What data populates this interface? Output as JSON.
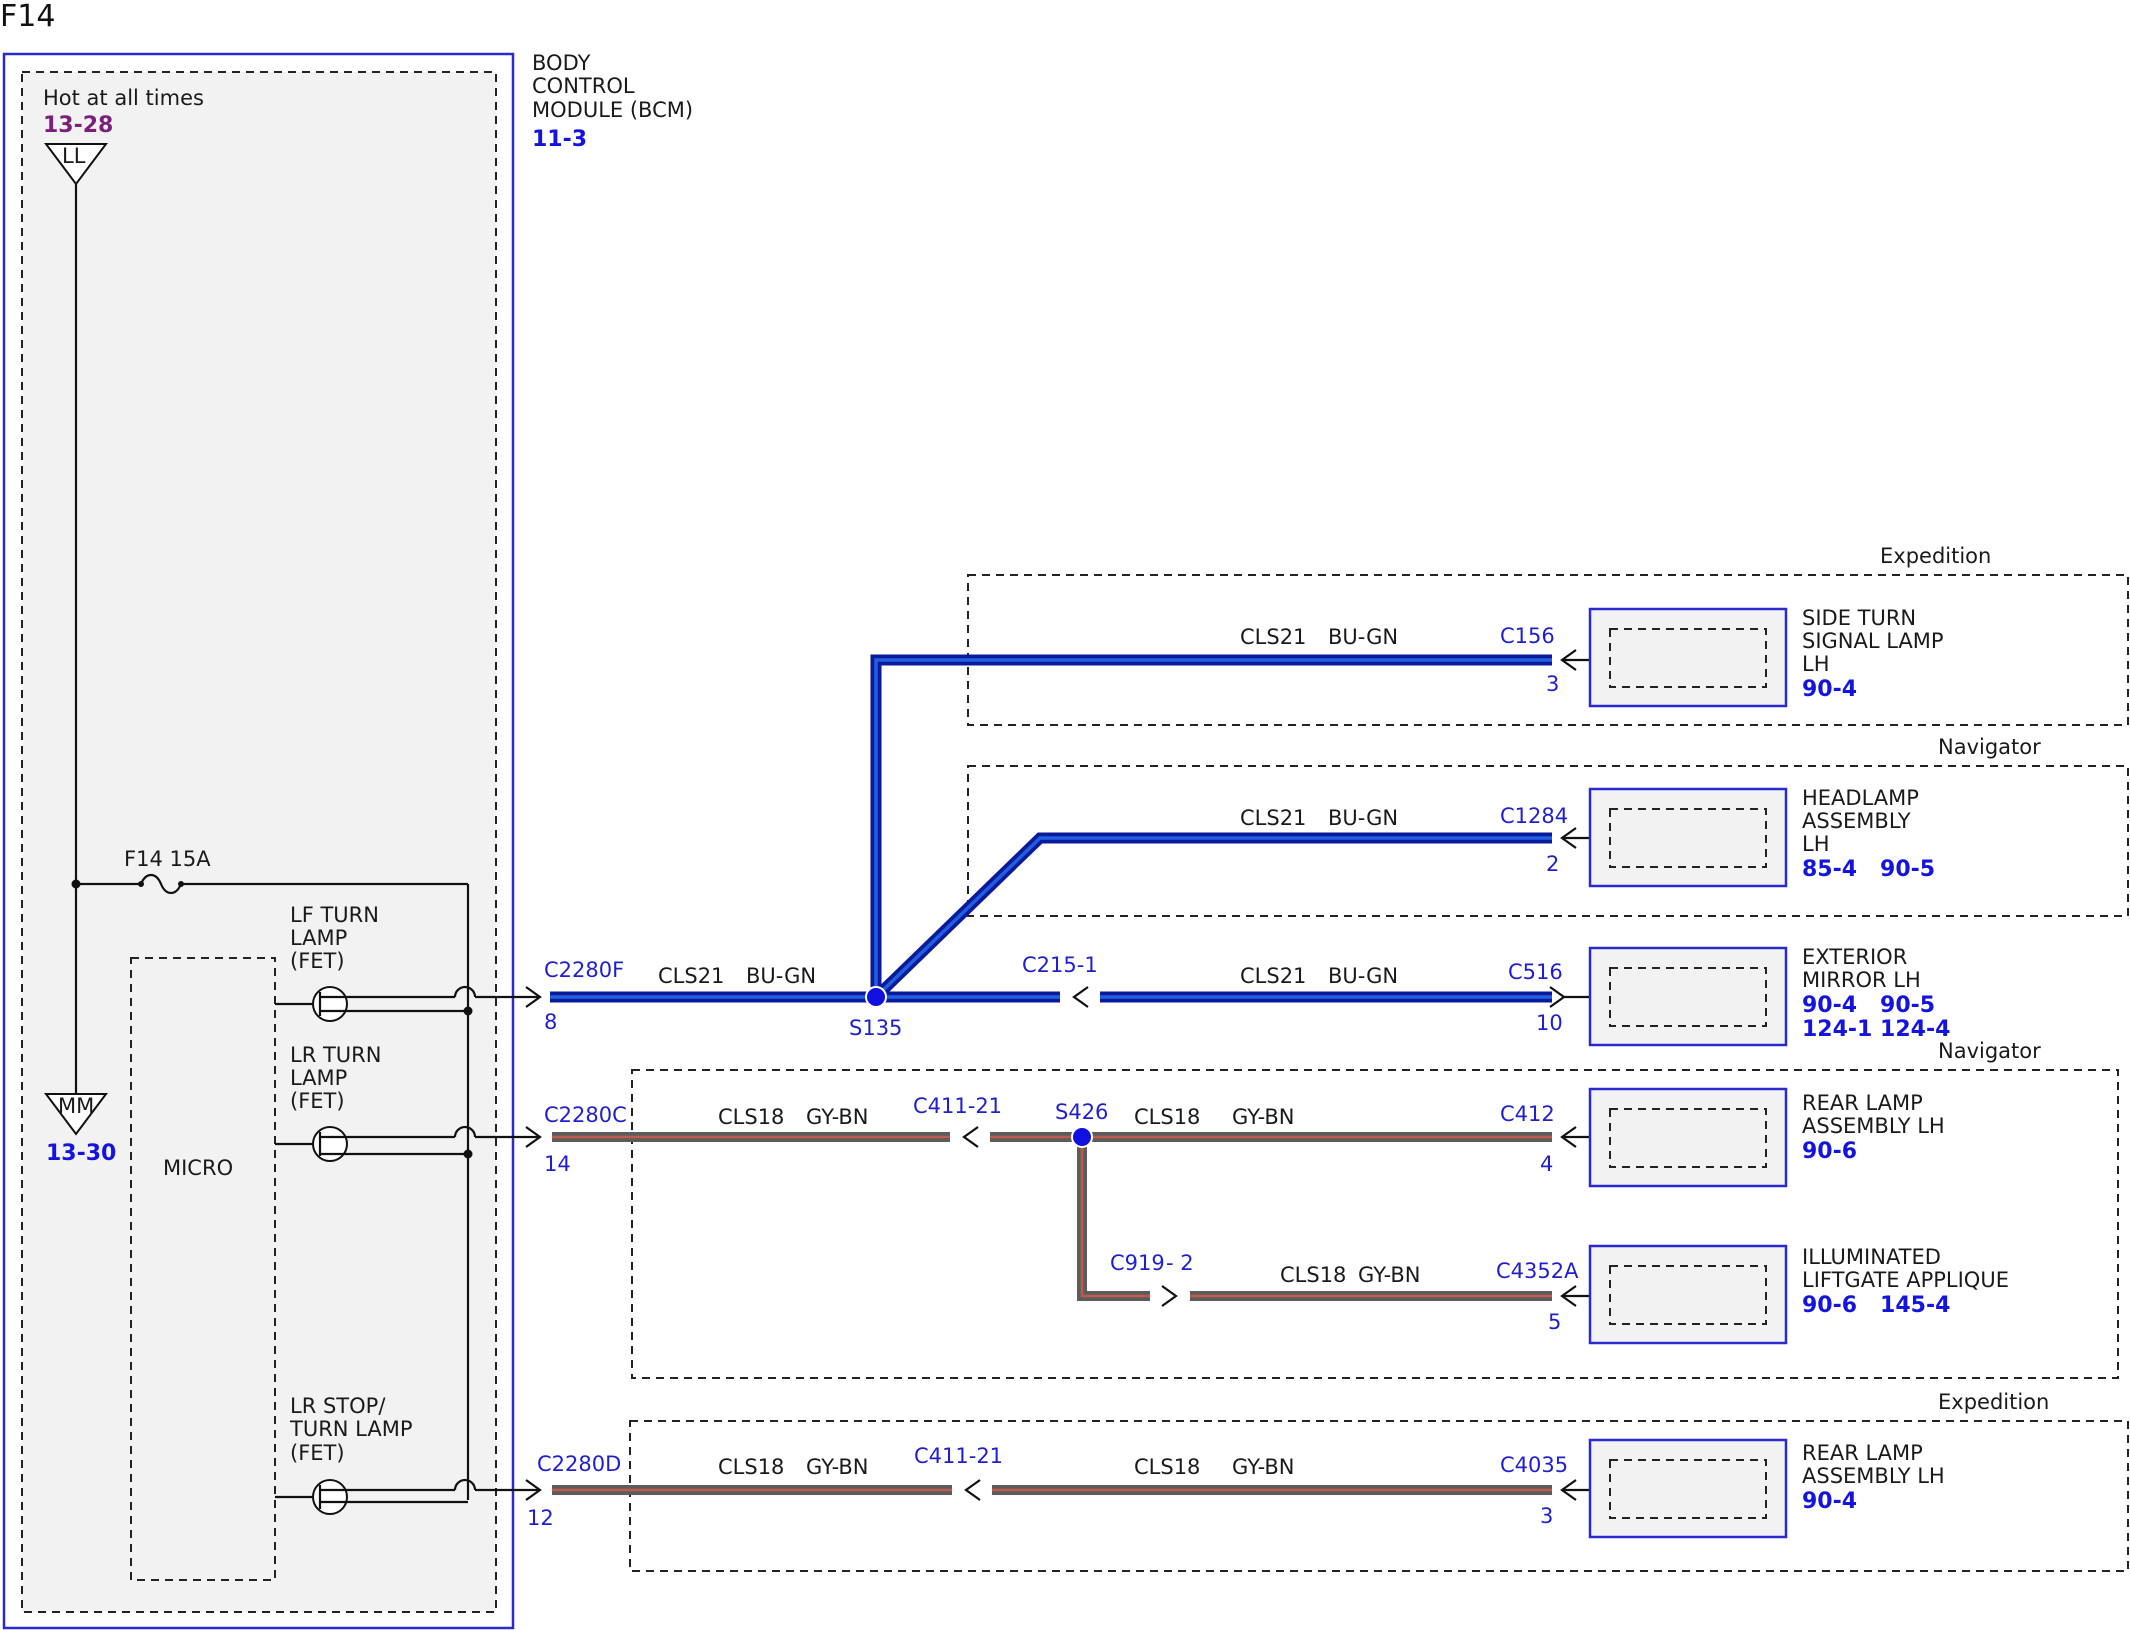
{
  "page": {
    "title": "F14"
  },
  "module": {
    "name_lines": [
      "BODY",
      "CONTROL",
      "MODULE (BCM)"
    ],
    "ref": "11-3",
    "hot_label": "Hot at all times",
    "hot_ref": "13-28",
    "top_terminal": "LL",
    "bottom_terminal": "MM",
    "bottom_ref": "13-30",
    "fuse_label": "F14  15A",
    "micro_label": "MICRO",
    "fet_lf_lines": [
      "LF TURN",
      "LAMP",
      "(FET)"
    ],
    "fet_lr_lines": [
      "LR TURN",
      "LAMP",
      "(FET)"
    ],
    "fet_stop_lines": [
      "LR STOP/",
      "TURN LAMP",
      "(FET)"
    ]
  },
  "outputs": [
    {
      "connector": "C2280F",
      "pin": "8"
    },
    {
      "connector": "C2280C",
      "pin": "14"
    },
    {
      "connector": "C2280D",
      "pin": "12"
    }
  ],
  "splices": {
    "s135": "S135",
    "s426": "S426"
  },
  "inline_connectors": {
    "c215": "C215-1",
    "c411_a": "C411-21",
    "c411_b": "C411-21",
    "c919": "C919",
    "c919_pin": "- 2"
  },
  "wire_labels": {
    "bcm_lf": {
      "circuit": "CLS21",
      "color": "BU-GN"
    },
    "side_turn": {
      "circuit": "CLS21",
      "color": "BU-GN"
    },
    "headlamp": {
      "circuit": "CLS21",
      "color": "BU-GN"
    },
    "mirror": {
      "circuit": "CLS21",
      "color": "BU-GN"
    },
    "bcm_lr": {
      "circuit": "CLS18",
      "color": "GY-BN"
    },
    "rear_nav": {
      "circuit": "CLS18",
      "color": "GY-BN"
    },
    "liftgate": {
      "circuit": "CLS18",
      "color": "GY-BN"
    },
    "bcm_stop": {
      "circuit": "CLS18",
      "color": "GY-BN"
    },
    "rear_exp": {
      "circuit": "CLS18",
      "color": "GY-BN"
    }
  },
  "groups": {
    "expedition_top": "Expedition",
    "navigator_head": "Navigator",
    "navigator_rear": "Navigator",
    "expedition_bottom": "Expedition"
  },
  "components": [
    {
      "key": "side_turn",
      "connector": "C156",
      "pin": "3",
      "name_lines": [
        "SIDE TURN",
        "SIGNAL LAMP",
        "LH"
      ],
      "refs": [
        "90-4"
      ]
    },
    {
      "key": "headlamp",
      "connector": "C1284",
      "pin": "2",
      "name_lines": [
        "HEADLAMP",
        "ASSEMBLY",
        "LH"
      ],
      "refs": [
        "85-4   90-5"
      ]
    },
    {
      "key": "mirror",
      "connector": "C516",
      "pin": "10",
      "name_lines": [
        "EXTERIOR",
        "MIRROR LH"
      ],
      "refs": [
        "90-4   90-5",
        "124-1 124-4"
      ]
    },
    {
      "key": "rear_nav",
      "connector": "C412",
      "pin": "4",
      "name_lines": [
        "REAR LAMP",
        "ASSEMBLY LH"
      ],
      "refs": [
        "90-6"
      ]
    },
    {
      "key": "liftgate",
      "connector": "C4352A",
      "pin": "5",
      "name_lines": [
        "ILLUMINATED",
        "LIFTGATE APPLIQUE"
      ],
      "refs": [
        "90-6   145-4"
      ]
    },
    {
      "key": "rear_exp",
      "connector": "C4035",
      "pin": "3",
      "name_lines": [
        "REAR LAMP",
        "ASSEMBLY LH"
      ],
      "refs": [
        "90-4"
      ]
    }
  ],
  "colors": {
    "wire_blue_outer": "#0a1a9a",
    "wire_blue_inner": "#1f5fe0",
    "wire_gray_outer": "#5c5c5c",
    "wire_gray_inner": "#c25a4a",
    "module_border": "#2a2ad0",
    "module_fill": "#f2f2f2",
    "splice": "#1010e0",
    "connector_text": "#1f1fcf",
    "ref_text": "#1414e0",
    "hot_ref_text": "#7a1f7a"
  }
}
